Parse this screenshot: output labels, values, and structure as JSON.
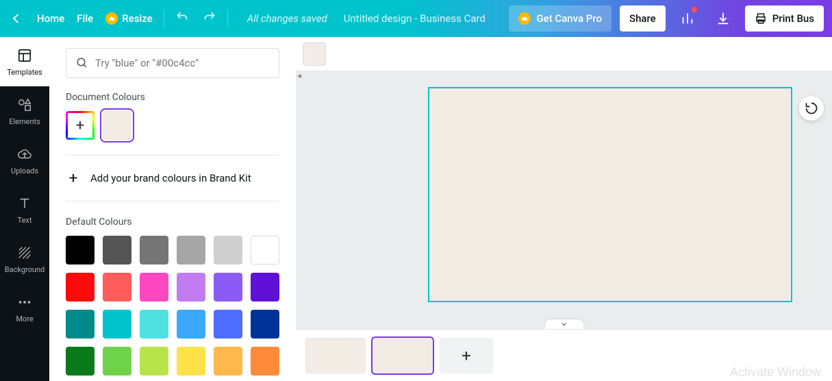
{
  "header": {
    "home": "Home",
    "file": "File",
    "resize": "Resize",
    "saved_status": "All changes saved",
    "design_title": "Untitled design - Business Card",
    "pro": "Get Canva Pro",
    "share": "Share",
    "print": "Print Bus"
  },
  "rail": {
    "templates": "Templates",
    "elements": "Elements",
    "uploads": "Uploads",
    "text": "Text",
    "background": "Background",
    "more": "More"
  },
  "panel": {
    "search_placeholder": "Try \"blue\" or \"#00c4cc\"",
    "doc_colours_label": "Document Colours",
    "doc_colour": "#f2ece4",
    "brand_kit": "Add your brand colours in Brand Kit",
    "default_label": "Default Colours",
    "default_colours": [
      "#000000",
      "#555555",
      "#757575",
      "#a6a6a6",
      "#cfcfcf",
      "#ffffff",
      "#ff0a0a",
      "#ff5c5c",
      "#ff47c2",
      "#c07cf0",
      "#8a5cf5",
      "#5f12d6",
      "#008a8a",
      "#00c4cc",
      "#4fe0e0",
      "#3aa8ff",
      "#4f6dff",
      "#003399",
      "#0a7a1a",
      "#6fd34a",
      "#b9e34a",
      "#ffe14a",
      "#ffb84a",
      "#ff8a3a"
    ]
  },
  "canvas": {
    "current_color": "#f2ece4",
    "page_bg": "#f2ece4"
  },
  "watermark": "Activate Window"
}
